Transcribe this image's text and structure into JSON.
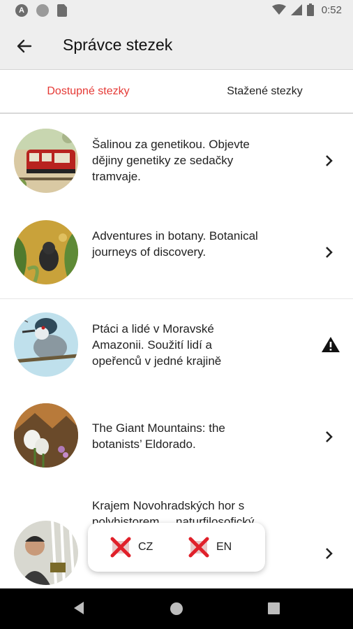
{
  "status_bar": {
    "time": "0:52",
    "icons": [
      "a-app-icon",
      "circle-icon",
      "sd-card-icon",
      "wifi-icon",
      "signal-icon",
      "battery-icon"
    ]
  },
  "app_bar": {
    "title": "Správce stezek",
    "back_icon": "arrow-left-icon"
  },
  "tabs": [
    {
      "label": "Dostupné stezky",
      "active": true
    },
    {
      "label": "Stažené stezky",
      "active": false
    }
  ],
  "colors": {
    "accent": "#e53935",
    "bar_bg": "#eeeeee",
    "nav_bg": "#000000"
  },
  "trails": [
    {
      "title": "Šalinou za genetikou. Objevte dějiny genetiky ze sedačky tramvaje.",
      "image": "tram-illustration",
      "action_icon": "chevron-right-icon"
    },
    {
      "title": "Adventures in botany. Botanical journeys of discovery.",
      "image": "jungle-panther-illustration",
      "action_icon": "chevron-right-icon"
    },
    {
      "title": "Ptáci a lidé v Moravské Amazonii. Soužití lidí a opeřenců v jedné krajině",
      "image": "heron-bird-illustration",
      "action_icon": "warning-icon"
    },
    {
      "title": "The Giant Mountains: the botanists’ Eldorado.",
      "image": "mountain-flowers-illustration",
      "action_icon": "chevron-right-icon"
    },
    {
      "title": "Krajem Novohradských hor s polyhistorem ... naturfilosofický kontext dějin přírodních věd první",
      "image": "polyhistor-portrait-illustration",
      "action_icon": "chevron-right-icon"
    }
  ],
  "language_popup": {
    "options": [
      {
        "label": "CZ",
        "icon": "crossed-flag-icon"
      },
      {
        "label": "EN",
        "icon": "crossed-flag-icon"
      }
    ]
  },
  "nav_bar": {
    "buttons": [
      "back-triangle-icon",
      "home-circle-icon",
      "recents-square-icon"
    ]
  }
}
